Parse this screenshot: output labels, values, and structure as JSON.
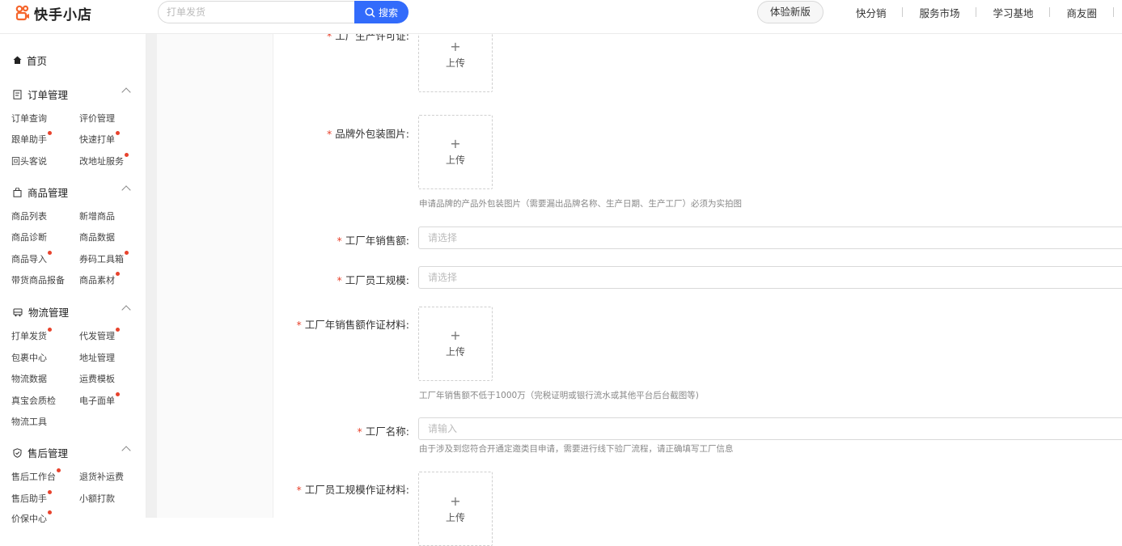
{
  "header": {
    "logo_text": "快手小店",
    "search_placeholder": "打单发货",
    "search_button": "搜索",
    "nav_pill": "体验新版",
    "nav_items": [
      "快分销",
      "服务市场",
      "学习基地",
      "商友圈"
    ]
  },
  "sidebar": {
    "home": "首页",
    "groups": [
      {
        "title": "订单管理",
        "items": [
          {
            "label": "订单查询",
            "dot": false
          },
          {
            "label": "评价管理",
            "dot": false
          },
          {
            "label": "跟单助手",
            "dot": true
          },
          {
            "label": "快速打单",
            "dot": true
          },
          {
            "label": "回头客说",
            "dot": false
          },
          {
            "label": "改地址服务",
            "dot": true
          }
        ]
      },
      {
        "title": "商品管理",
        "items": [
          {
            "label": "商品列表",
            "dot": false
          },
          {
            "label": "新增商品",
            "dot": false
          },
          {
            "label": "商品诊断",
            "dot": false
          },
          {
            "label": "商品数据",
            "dot": false
          },
          {
            "label": "商品导入",
            "dot": true
          },
          {
            "label": "券码工具箱",
            "dot": true
          },
          {
            "label": "带货商品报备",
            "dot": false
          },
          {
            "label": "商品素材",
            "dot": true
          }
        ]
      },
      {
        "title": "物流管理",
        "items": [
          {
            "label": "打单发货",
            "dot": true
          },
          {
            "label": "代发管理",
            "dot": true
          },
          {
            "label": "包裹中心",
            "dot": false
          },
          {
            "label": "地址管理",
            "dot": false
          },
          {
            "label": "物流数据",
            "dot": false
          },
          {
            "label": "运费模板",
            "dot": false
          },
          {
            "label": "真宝会质检",
            "dot": false
          },
          {
            "label": "电子面单",
            "dot": true
          },
          {
            "label": "物流工具",
            "dot": false
          }
        ]
      },
      {
        "title": "售后管理",
        "items": [
          {
            "label": "售后工作台",
            "dot": true
          },
          {
            "label": "退货补运费",
            "dot": false
          },
          {
            "label": "售后助手",
            "dot": true
          },
          {
            "label": "小额打款",
            "dot": false
          },
          {
            "label": "价保中心",
            "dot": true
          }
        ]
      }
    ]
  },
  "form": {
    "required_mark": "*",
    "upload_plus": "+",
    "upload_label": "上传",
    "fields": {
      "license_label": "工厂生产许可证:",
      "packaging_label": "品牌外包装图片:",
      "packaging_hint": "申请品牌的产品外包装图片（需要漏出品牌名称、生产日期、生产工厂）必须为实拍图",
      "sales_label": "工厂年销售额:",
      "sales_placeholder": "请选择",
      "staff_label": "工厂员工规模:",
      "staff_placeholder": "请选择",
      "sales_proof_label": "工厂年销售额作证材料:",
      "sales_proof_hint": "工厂年销售额不低于1000万（完税证明或银行流水或其他平台后台截图等)",
      "name_label": "工厂名称:",
      "name_placeholder": "请输入",
      "name_hint": "由于涉及到您符合开通定邀类目申请，需要进行线下验厂流程，请正确填写工厂信息",
      "staff_proof_label": "工厂员工规模作证材料:"
    }
  },
  "colors": {
    "accent": "#326bfb",
    "required": "#e8432d",
    "logo": "#f5662d"
  }
}
